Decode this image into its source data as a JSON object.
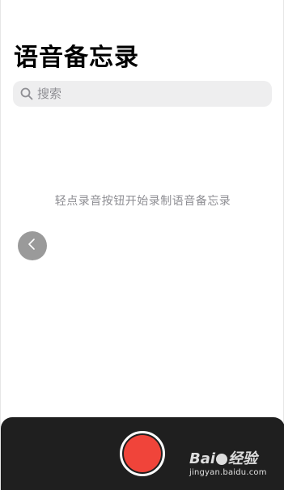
{
  "header": {
    "title": "语音备忘录"
  },
  "search": {
    "placeholder": "搜索"
  },
  "main": {
    "empty_hint": "轻点录音按钮开始录制语音备忘录"
  },
  "icons": {
    "search": "magnifier",
    "back_float": "chevron-left",
    "record": "record-circle"
  },
  "colors": {
    "record": "#f0443a",
    "bottom_bar": "#1f1f1f",
    "search_bg": "#eeeeef",
    "hint_text": "#8e8e93"
  },
  "watermark": {
    "brand_left": "Bai",
    "brand_right": "经验",
    "url": "jingyan.baidu.com"
  }
}
